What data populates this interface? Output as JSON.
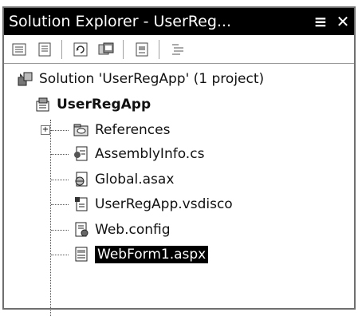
{
  "window": {
    "title": "Solution Explorer - UserReg...",
    "pin_glyph": "≡",
    "close_glyph": "✕"
  },
  "toolbar": {
    "buttons": [
      {
        "name": "properties-icon"
      },
      {
        "name": "show-all-files-icon"
      },
      {
        "name": "refresh-icon"
      },
      {
        "name": "view-code-icon"
      },
      {
        "name": "view-designer-icon"
      },
      {
        "name": "nest-related-files-icon"
      }
    ]
  },
  "tree": {
    "solution": "Solution 'UserRegApp' (1 project)",
    "project": "UserRegApp",
    "expander_glyph": "+",
    "items": [
      {
        "label": "References",
        "icon": "references-icon"
      },
      {
        "label": "AssemblyInfo.cs",
        "icon": "cs-file-icon"
      },
      {
        "label": "Global.asax",
        "icon": "global-asax-icon"
      },
      {
        "label": "UserRegApp.vsdisco",
        "icon": "vsdisco-file-icon"
      },
      {
        "label": "Web.config",
        "icon": "config-file-icon"
      },
      {
        "label": "WebForm1.aspx",
        "icon": "aspx-file-icon",
        "selected": true
      }
    ]
  }
}
